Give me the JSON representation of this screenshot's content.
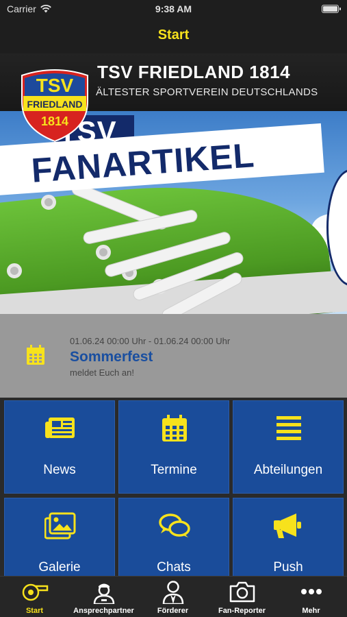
{
  "status": {
    "carrier": "Carrier",
    "time": "9:38 AM"
  },
  "nav": {
    "title": "Start"
  },
  "hero": {
    "club_name": "TSV FRIEDLAND 1814",
    "club_tagline": "ÄLTESTER SPORTVEREIN DEUTSCHLANDS",
    "logo": {
      "top": "TSV",
      "middle": "FRIEDLAND",
      "bottom": "1814"
    },
    "banner": {
      "tsv": "TSV",
      "headline": "FANARTIKEL"
    }
  },
  "event": {
    "datetime": "01.06.24 00:00 Uhr - 01.06.24 00:00 Uhr",
    "title": "Sommerfest",
    "description": "meldet Euch an!",
    "icon": "calendar-icon"
  },
  "tiles": [
    {
      "label": "News",
      "icon": "newspaper-icon"
    },
    {
      "label": "Termine",
      "icon": "calendar-icon"
    },
    {
      "label": "Abteilungen",
      "icon": "list-icon"
    },
    {
      "label": "Galerie",
      "icon": "images-icon"
    },
    {
      "label": "Chats",
      "icon": "chat-bubbles-icon"
    },
    {
      "label": "Push",
      "icon": "megaphone-icon"
    }
  ],
  "tabbar": [
    {
      "label": "Start",
      "icon": "whistle-icon",
      "active": true
    },
    {
      "label": "Ansprechpartner",
      "icon": "person-cap-icon",
      "active": false
    },
    {
      "label": "Förderer",
      "icon": "person-suit-icon",
      "active": false
    },
    {
      "label": "Fan-Reporter",
      "icon": "camera-icon",
      "active": false
    },
    {
      "label": "Mehr",
      "icon": "more-dots-icon",
      "active": false
    }
  ],
  "colors": {
    "accent_yellow": "#f7e21c",
    "tile_blue": "#1a4c9a",
    "event_title_blue": "#1a4fa0",
    "background": "#1a1a1a"
  }
}
